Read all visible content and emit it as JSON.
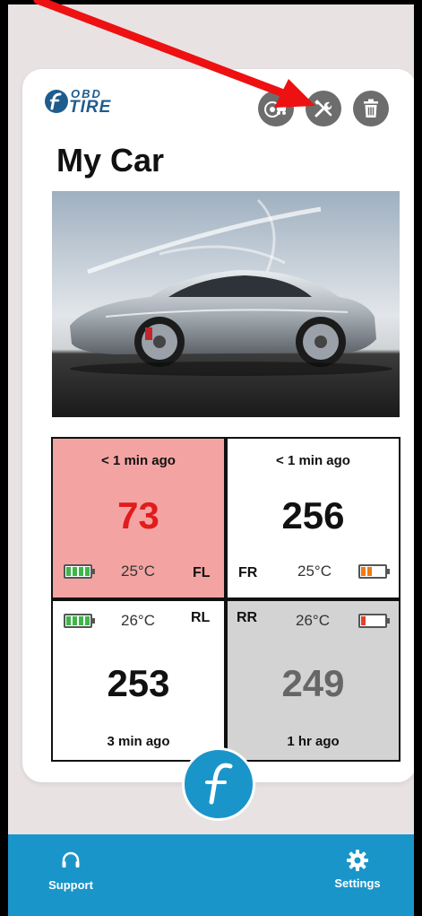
{
  "header": {
    "logo_top": "OBD",
    "logo_bottom": "TIRE",
    "title": "My Car",
    "icons": [
      "car-sensor-icon",
      "tools-icon",
      "trash-icon"
    ]
  },
  "tires": {
    "fl": {
      "time": "< 1 min ago",
      "value": "73",
      "temp": "25°C",
      "pos": "FL",
      "battery": 1.0,
      "value_color": "#e01c1c",
      "status": "alert"
    },
    "fr": {
      "time": "< 1 min ago",
      "value": "256",
      "temp": "25°C",
      "pos": "FR",
      "battery": 0.5,
      "value_color": "#111111",
      "status": "ok"
    },
    "rl": {
      "time": "3 min ago",
      "value": "253",
      "temp": "26°C",
      "pos": "RL",
      "battery": 1.0,
      "value_color": "#111111",
      "status": "ok"
    },
    "rr": {
      "time": "1 hr ago",
      "value": "249",
      "temp": "26°C",
      "pos": "RR",
      "battery": 0.25,
      "value_color": "#666666",
      "status": "stale"
    }
  },
  "pager": {
    "count": 3,
    "active": 1
  },
  "bottom_nav": {
    "support_label": "Support",
    "settings_label": "Settings"
  },
  "colors": {
    "accent": "#1a95c9",
    "alert_bg": "#f3a4a2",
    "stale_bg": "#d3d3d3",
    "battery_green": "#3fb64a",
    "battery_orange": "#f07a12",
    "battery_red": "#e5412a",
    "arrow": "#ee1111"
  }
}
